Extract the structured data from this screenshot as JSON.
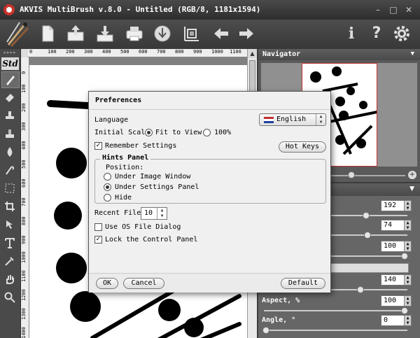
{
  "window": {
    "title": "AKVIS MultiBrush v.8.0 - Untitled (RGB/8, 1181x1594)",
    "minimize": "–",
    "maximize": "□",
    "close": "✕"
  },
  "toolbar": {
    "buttons": [
      "new-file",
      "open-image",
      "save-image",
      "print",
      "export-to-web",
      "canvas-size",
      "undo",
      "redo",
      "about",
      "help",
      "preferences"
    ],
    "about_glyph": "i",
    "help_glyph": "?"
  },
  "tools": {
    "std_label": "Std",
    "items": [
      "brush",
      "eraser",
      "clone-stamp",
      "pattern-stamp",
      "blur",
      "smudge",
      "selection",
      "crop",
      "move",
      "text",
      "eyedropper",
      "hand",
      "zoom"
    ]
  },
  "rulers": {
    "horizontal": [
      "0",
      "100",
      "200",
      "300",
      "400",
      "500",
      "600",
      "700",
      "800",
      "900",
      "1000",
      "1100"
    ],
    "vertical": [
      "0",
      "100",
      "200",
      "300",
      "400",
      "500",
      "600",
      "700",
      "800",
      "900",
      "1000",
      "1100",
      "1200",
      "1300",
      "1400"
    ]
  },
  "navigator": {
    "title": "Navigator",
    "zoom_level": 0.6
  },
  "settings_panel": {
    "rows": [
      {
        "label": "",
        "value": "192",
        "slider": 0.72
      },
      {
        "label": "",
        "value": "74",
        "slider": 0.73
      },
      {
        "label": "",
        "value": "100",
        "slider": 1.0
      },
      {
        "label": "",
        "value": "140",
        "slider": 0.68
      },
      {
        "label": "Aspect, %",
        "value": "100",
        "slider": 1.0
      },
      {
        "label": "Angle, °",
        "value": "0",
        "slider": 0.0
      }
    ]
  },
  "dialog": {
    "title": "Preferences",
    "language_label": "Language",
    "language_value": "English",
    "initial_scale_label": "Initial Scale",
    "scale_fit": "Fit to View",
    "scale_100": "100%",
    "scale_selected": "fit",
    "remember_settings": "Remember Settings",
    "remember_checked": true,
    "hot_keys": "Hot Keys",
    "hints_panel_title": "Hints Panel",
    "position_label": "Position:",
    "hints_under_window": "Under Image Window",
    "hints_under_settings": "Under Settings Panel",
    "hints_hide": "Hide",
    "hints_selected": "under_settings",
    "recent_files_label": "Recent Files",
    "recent_files_value": "10",
    "use_os_dialog": "Use OS File Dialog",
    "use_os_checked": false,
    "lock_control_panel": "Lock the Control Panel",
    "lock_checked": true,
    "ok": "OK",
    "cancel": "Cancel",
    "default": "Default"
  },
  "colors": {
    "chrome_dark": "#3c3c3c",
    "panel_gray": "#666666",
    "dialog_bg": "#f0f0f0",
    "navigator_frame": "#c03030"
  }
}
